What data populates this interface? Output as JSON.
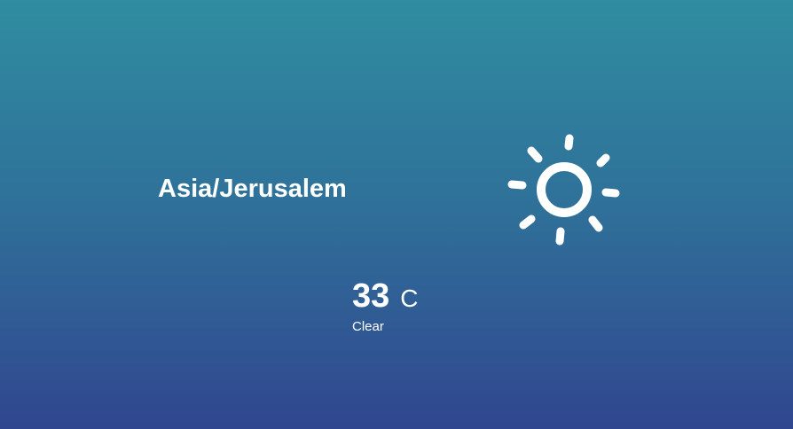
{
  "city": {
    "name": "Asia/Jerusalem"
  },
  "weather": {
    "temperature": "33",
    "unit": "C",
    "condition": "Clear",
    "icon": "sun-icon"
  },
  "theme": {
    "gradient_top": "#2f8da0",
    "gradient_bottom": "#30468f",
    "text_color": "#ffffff"
  }
}
